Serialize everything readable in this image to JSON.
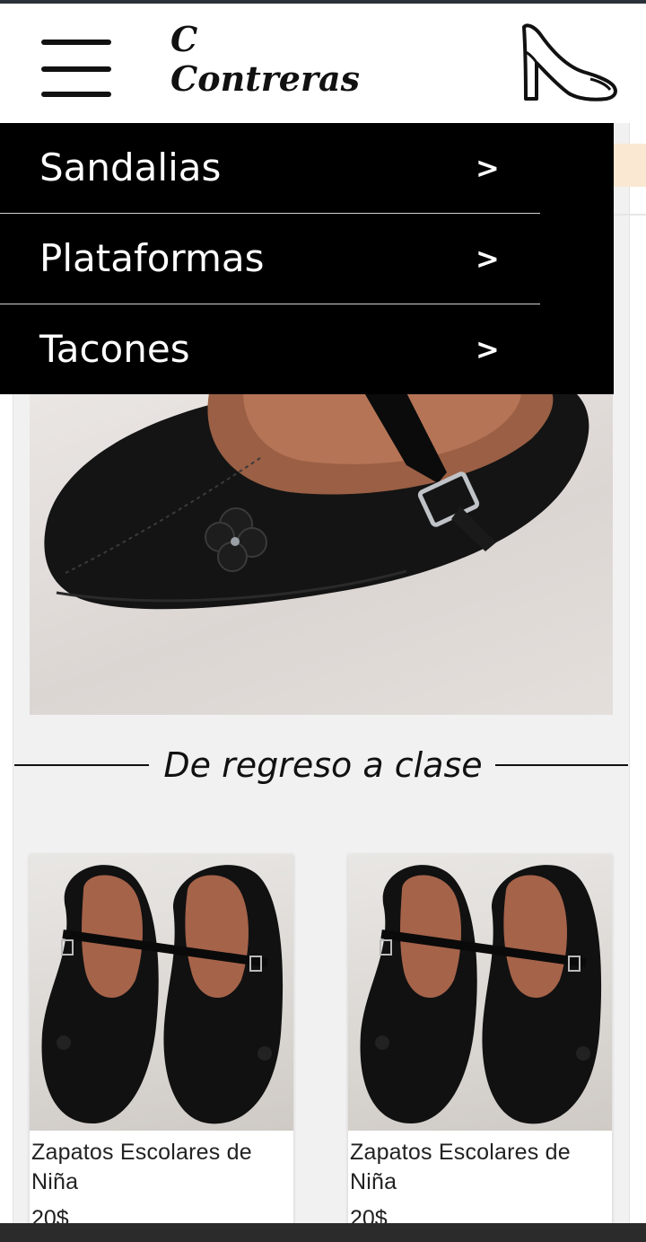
{
  "header": {
    "brand_line1": "C",
    "brand_line2": "Contreras",
    "menu_icon": "hamburger-icon",
    "logo_icon": "high-heel-shoe-icon"
  },
  "menu": {
    "items": [
      {
        "label": "Sandalias",
        "arrow": ">"
      },
      {
        "label": "Plataformas",
        "arrow": ">"
      },
      {
        "label": "Tacones",
        "arrow": ">"
      }
    ]
  },
  "section": {
    "title": "De regreso a clase"
  },
  "products": [
    {
      "name": "Zapatos Escolares de Niña",
      "price": "20$"
    },
    {
      "name": "Zapatos Escolares de Niña",
      "price": "20$"
    }
  ],
  "colors": {
    "menu_bg": "#000000",
    "accent_strip": "#fbe8d3",
    "page_bg": "#f1f1f1"
  }
}
